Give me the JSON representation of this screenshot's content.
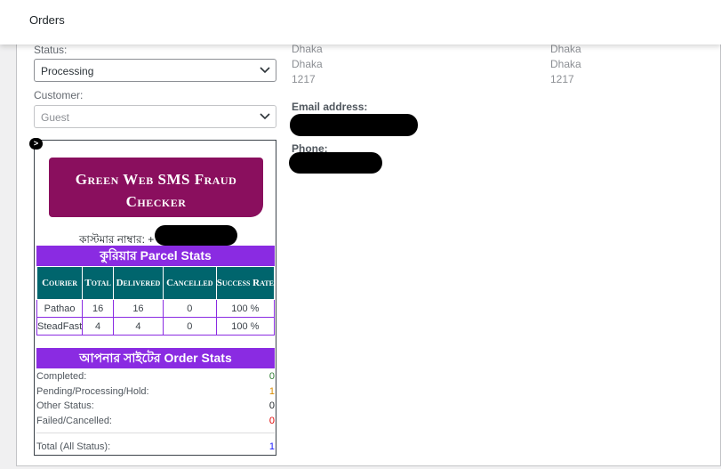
{
  "header": {
    "title": "Orders"
  },
  "status": {
    "label": "Status:",
    "value": "Processing"
  },
  "customer": {
    "label": "Customer:",
    "value": "Guest"
  },
  "billing_address": {
    "line1": "Dhaka",
    "line2": "Dhaka",
    "line3": "1217"
  },
  "shipping_address": {
    "line1": "Dhaka",
    "line2": "Dhaka",
    "line3": "1217"
  },
  "email": {
    "label": "Email address:"
  },
  "phone": {
    "label": "Phone:"
  },
  "widget": {
    "toggle": ">",
    "brand_line1": "Green Web SMS Fraud",
    "brand_line2": "Checker",
    "customer_number_label": "কাস্টমার নাম্বার: +",
    "parcel_heading": "কুরিয়ার Parcel Stats",
    "parcel_columns": [
      "Courier",
      "Total",
      "Delivered",
      "Cancelled",
      "Success Rate"
    ],
    "parcel_rows": [
      [
        "Pathao",
        "16",
        "16",
        "0",
        "100 %"
      ],
      [
        "SteadFast",
        "4",
        "4",
        "0",
        "100 %"
      ]
    ],
    "order_heading": "আপনার সাইটের Order Stats",
    "order_stats": [
      {
        "label": "Completed:",
        "value": "0",
        "color": "#2e7d32"
      },
      {
        "label": "Pending/Processing/Hold:",
        "value": "1",
        "color": "#d98c00"
      },
      {
        "label": "Other Status:",
        "value": "0",
        "color": "#1d2327"
      },
      {
        "label": "Failed/Cancelled:",
        "value": "0",
        "color": "#e00000"
      }
    ],
    "total": {
      "label": "Total (All Status):",
      "value": "1",
      "color": "#1a1aff"
    }
  }
}
